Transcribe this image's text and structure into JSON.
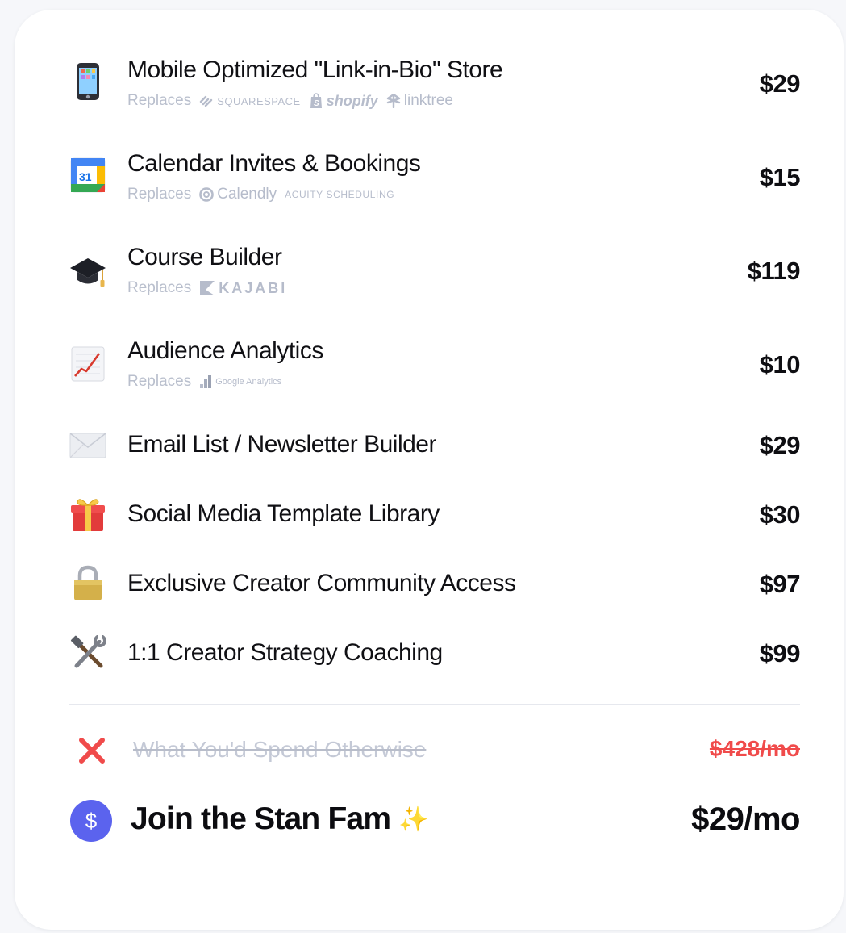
{
  "replaces_label": "Replaces",
  "items": [
    {
      "title": "Mobile Optimized \"Link-in-Bio\" Store",
      "price": "$29",
      "icon": "mobile-phone-icon",
      "replaces": [
        "SQUARESPACE",
        "shopify",
        "linktree"
      ]
    },
    {
      "title": "Calendar Invites & Bookings",
      "price": "$15",
      "icon": "calendar-icon",
      "calendar_day": "31",
      "replaces": [
        "Calendly",
        "ACUITY SCHEDULING"
      ]
    },
    {
      "title": "Course Builder",
      "price": "$119",
      "icon": "graduation-cap-icon",
      "replaces": [
        "KAJABI"
      ]
    },
    {
      "title": "Audience Analytics",
      "price": "$10",
      "icon": "chart-increasing-icon",
      "replaces": [
        "Google Analytics"
      ]
    },
    {
      "title": "Email List / Newsletter Builder",
      "price": "$29",
      "icon": "envelope-icon"
    },
    {
      "title": "Social Media Template Library",
      "price": "$30",
      "icon": "gift-icon"
    },
    {
      "title": "Exclusive Creator Community Access",
      "price": "$97",
      "icon": "lock-icon"
    },
    {
      "title": "1:1 Creator Strategy Coaching",
      "price": "$99",
      "icon": "hammer-and-wrench-icon"
    }
  ],
  "otherwise": {
    "label": "What You'd Spend Otherwise",
    "price": "$428/mo",
    "icon": "cross-mark-icon",
    "color": "#f04b4b"
  },
  "stan": {
    "label": "Join the Stan Fam",
    "price": "$29/mo",
    "icon": "dollar-circle-icon",
    "icon_glyph": "$",
    "sparkle": "✨",
    "color": "#5b63ee"
  }
}
